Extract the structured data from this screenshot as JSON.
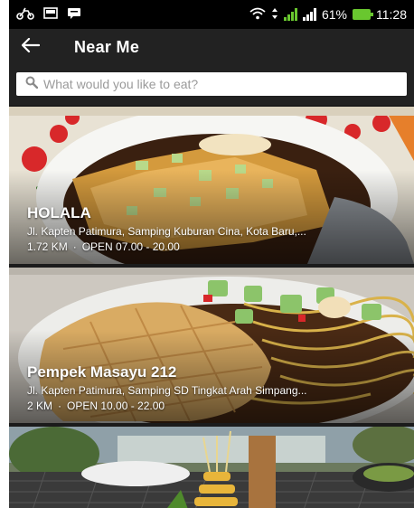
{
  "status_bar": {
    "battery": "61%",
    "time": "11:28"
  },
  "app_bar": {
    "title": "Near Me"
  },
  "search": {
    "placeholder": "What would you like to eat?"
  },
  "restaurants": [
    {
      "name": "HOLALA",
      "address": "Jl. Kapten Patimura, Samping Kuburan Cina, Kota Baru,...",
      "distance": "1.72 KM",
      "hours": "OPEN 07.00 - 20.00"
    },
    {
      "name": "Pempek Masayu 212",
      "address": "Jl. Kapten Patimura, Samping SD Tingkat Arah Simpang...",
      "distance": "2 KM",
      "hours": "OPEN 10.00 - 22.00"
    },
    {
      "name": "",
      "address": "",
      "distance": "",
      "hours": ""
    }
  ],
  "icons": {
    "back": "arrow-left-icon",
    "search": "magnifier-icon"
  },
  "colors": {
    "app_bar": "#222222",
    "status_bar": "#000000",
    "signal_green": "#69c72f"
  }
}
